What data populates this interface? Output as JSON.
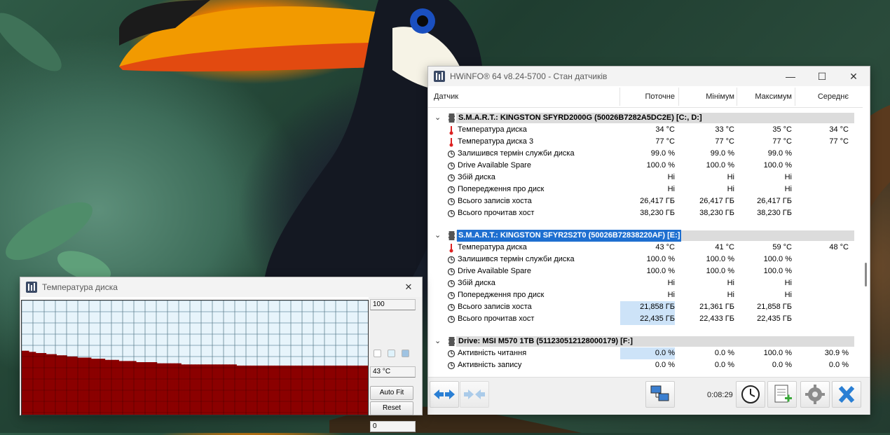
{
  "main_window": {
    "title": "HWiNFO® 64 v8.24-5700 - Стан датчиків",
    "minimize_glyph": "—",
    "maximize_glyph": "☐",
    "close_glyph": "✕",
    "columns": {
      "sensor": "Датчик",
      "current": "Поточне",
      "min": "Мінімум",
      "max": "Максимум",
      "avg": "Середнє"
    },
    "groups": [
      {
        "title": "S.M.A.R.T.: KINGSTON SFYRD2000G (50026B7282A5DC2E) [C:, D:]",
        "selected": false,
        "rows": [
          {
            "icon": "thermometer-icon",
            "label": "Температура диска",
            "cur": "34 °C",
            "min": "33 °C",
            "max": "35 °C",
            "avg": "34 °C"
          },
          {
            "icon": "thermometer-icon",
            "label": "Температура диска 3",
            "cur": "77 °C",
            "min": "77 °C",
            "max": "77 °C",
            "avg": "77 °C"
          },
          {
            "icon": "gauge-icon",
            "label": "Залишився термін служби диска",
            "cur": "99.0 %",
            "min": "99.0 %",
            "max": "99.0 %",
            "avg": ""
          },
          {
            "icon": "gauge-icon",
            "label": "Drive Available Spare",
            "cur": "100.0 %",
            "min": "100.0 %",
            "max": "100.0 %",
            "avg": ""
          },
          {
            "icon": "gauge-icon",
            "label": "Збій диска",
            "cur": "Ні",
            "min": "Ні",
            "max": "Ні",
            "avg": ""
          },
          {
            "icon": "gauge-icon",
            "label": "Попередження про диск",
            "cur": "Ні",
            "min": "Ні",
            "max": "Ні",
            "avg": ""
          },
          {
            "icon": "gauge-icon",
            "label": "Всього записів хоста",
            "cur": "26,417 ГБ",
            "min": "26,417 ГБ",
            "max": "26,417 ГБ",
            "avg": ""
          },
          {
            "icon": "gauge-icon",
            "label": "Всього прочитав хост",
            "cur": "38,230 ГБ",
            "min": "38,230 ГБ",
            "max": "38,230 ГБ",
            "avg": ""
          }
        ]
      },
      {
        "title": "S.M.A.R.T.: KINGSTON SFYR2S2T0 (50026B72838220AF) [E:]",
        "selected": true,
        "rows": [
          {
            "icon": "thermometer-icon",
            "label": "Температура диска",
            "cur": "43 °C",
            "min": "41 °C",
            "max": "59 °C",
            "avg": "48 °C"
          },
          {
            "icon": "gauge-icon",
            "label": "Залишився термін служби диска",
            "cur": "100.0 %",
            "min": "100.0 %",
            "max": "100.0 %",
            "avg": ""
          },
          {
            "icon": "gauge-icon",
            "label": "Drive Available Spare",
            "cur": "100.0 %",
            "min": "100.0 %",
            "max": "100.0 %",
            "avg": ""
          },
          {
            "icon": "gauge-icon",
            "label": "Збій диска",
            "cur": "Ні",
            "min": "Ні",
            "max": "Ні",
            "avg": ""
          },
          {
            "icon": "gauge-icon",
            "label": "Попередження про диск",
            "cur": "Ні",
            "min": "Ні",
            "max": "Ні",
            "avg": ""
          },
          {
            "icon": "gauge-icon",
            "label": "Всього записів хоста",
            "cur": "21,858 ГБ",
            "min": "21,361 ГБ",
            "max": "21,858 ГБ",
            "avg": "",
            "highlight": true
          },
          {
            "icon": "gauge-icon",
            "label": "Всього прочитав хост",
            "cur": "22,435 ГБ",
            "min": "22,433 ГБ",
            "max": "22,435 ГБ",
            "avg": "",
            "highlight": true
          }
        ]
      },
      {
        "title": "Drive: MSI M570 1TB (511230512128000179) [F:]",
        "selected": false,
        "rows": [
          {
            "icon": "gauge-icon",
            "label": "Активність читання",
            "cur": "0.0 %",
            "min": "0.0 %",
            "max": "100.0 %",
            "avg": "30.9 %",
            "highlight": true
          },
          {
            "icon": "gauge-icon",
            "label": "Активність запису",
            "cur": "0.0 %",
            "min": "0.0 %",
            "max": "0.0 %",
            "avg": "0.0 %"
          }
        ]
      }
    ],
    "footer": {
      "elapsed": "0:08:29"
    }
  },
  "graph_window": {
    "title": "Температура диска",
    "close_glyph": "✕",
    "max_label": "100",
    "current_label": "43 °C",
    "min_label": "0",
    "autofit_label": "Auto Fit",
    "reset_label": "Reset",
    "series_color": "#8b0000",
    "ymax": 100,
    "values": [
      56,
      56,
      55,
      55,
      54,
      54,
      54,
      53,
      53,
      53,
      52,
      52,
      52,
      51,
      51,
      51,
      50,
      50,
      50,
      50,
      49,
      49,
      49,
      49,
      48,
      48,
      48,
      48,
      47,
      47,
      47,
      47,
      47,
      46,
      46,
      46,
      46,
      46,
      46,
      45,
      45,
      45,
      45,
      45,
      45,
      45,
      44,
      44,
      44,
      44,
      44,
      44,
      44,
      44,
      44,
      44,
      44,
      44,
      44,
      44,
      44,
      44,
      43,
      43,
      43,
      43,
      43,
      43,
      43,
      43,
      43,
      43,
      43,
      43,
      43,
      43,
      43,
      43,
      43,
      43,
      43,
      43,
      43,
      43,
      43,
      43,
      43,
      43,
      43,
      43,
      43,
      43,
      43,
      43,
      43,
      43,
      43,
      43,
      43,
      43
    ]
  }
}
